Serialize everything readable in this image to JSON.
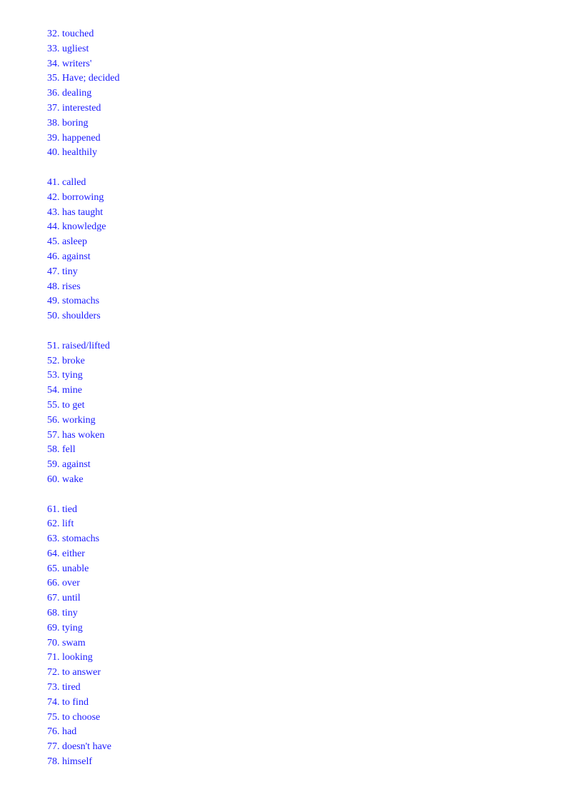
{
  "groups": [
    [
      "32. touched",
      "33. ugliest",
      "34. writers'",
      "35. Have; decided",
      "36. dealing",
      "37. interested",
      "38. boring",
      "39. happened",
      "40. healthily"
    ],
    [
      "41. called",
      "42. borrowing",
      "43. has taught",
      "44. knowledge",
      "45. asleep",
      "46. against",
      "47. tiny",
      "48. rises",
      "49. stomachs",
      "50. shoulders"
    ],
    [
      "51. raised/lifted",
      "52. broke",
      "53. tying",
      "54. mine",
      "55. to get",
      "56. working",
      "57. has woken",
      "58. fell",
      "59. against",
      "60. wake"
    ],
    [
      "61. tied",
      "62. lift",
      "63. stomachs",
      "64. either",
      "65. unable",
      "66. over",
      "67. until",
      "68. tiny",
      "69. tying",
      "70. swam",
      "71. looking",
      "72. to answer",
      "73. tired",
      "74. to find",
      "75. to choose",
      "76. had",
      "77. doesn't have",
      "78. himself"
    ]
  ],
  "text_color": "#1a1aff"
}
